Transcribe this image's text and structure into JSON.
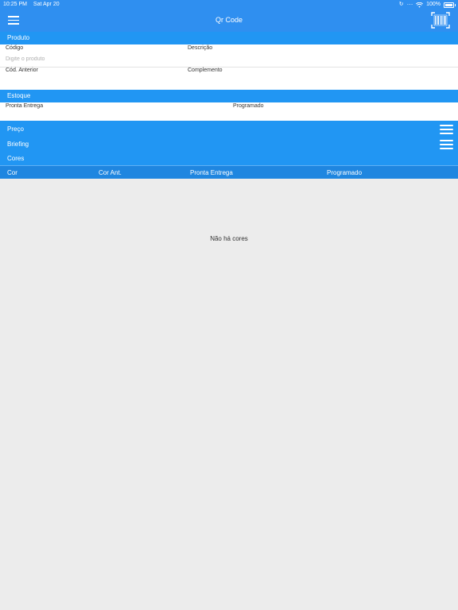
{
  "status": {
    "time": "10:25 PM",
    "date": "Sat Apr 20",
    "battery": "100%"
  },
  "navbar": {
    "title": "Qr Code"
  },
  "produto": {
    "header": "Produto",
    "codigo_label": "Código",
    "codigo_placeholder": "Digite o produto",
    "descricao_label": "Descrição",
    "cod_anterior_label": "Cód. Anterior",
    "complemento_label": "Complemento"
  },
  "estoque": {
    "header": "Estoque",
    "pronta_entrega_label": "Pronta Entrega",
    "programado_label": "Programado"
  },
  "sections": {
    "preco": "Preço",
    "briefing": "Briefing",
    "cores": "Cores"
  },
  "table": {
    "columns": [
      "Cor",
      "Cor Ant.",
      "Pronta Entrega",
      "Programado"
    ],
    "empty_message": "Não há cores"
  },
  "colors": {
    "primary": "#2f8ff0",
    "section": "#2196f3",
    "table_header": "#1f86e0",
    "background": "#ececec"
  }
}
